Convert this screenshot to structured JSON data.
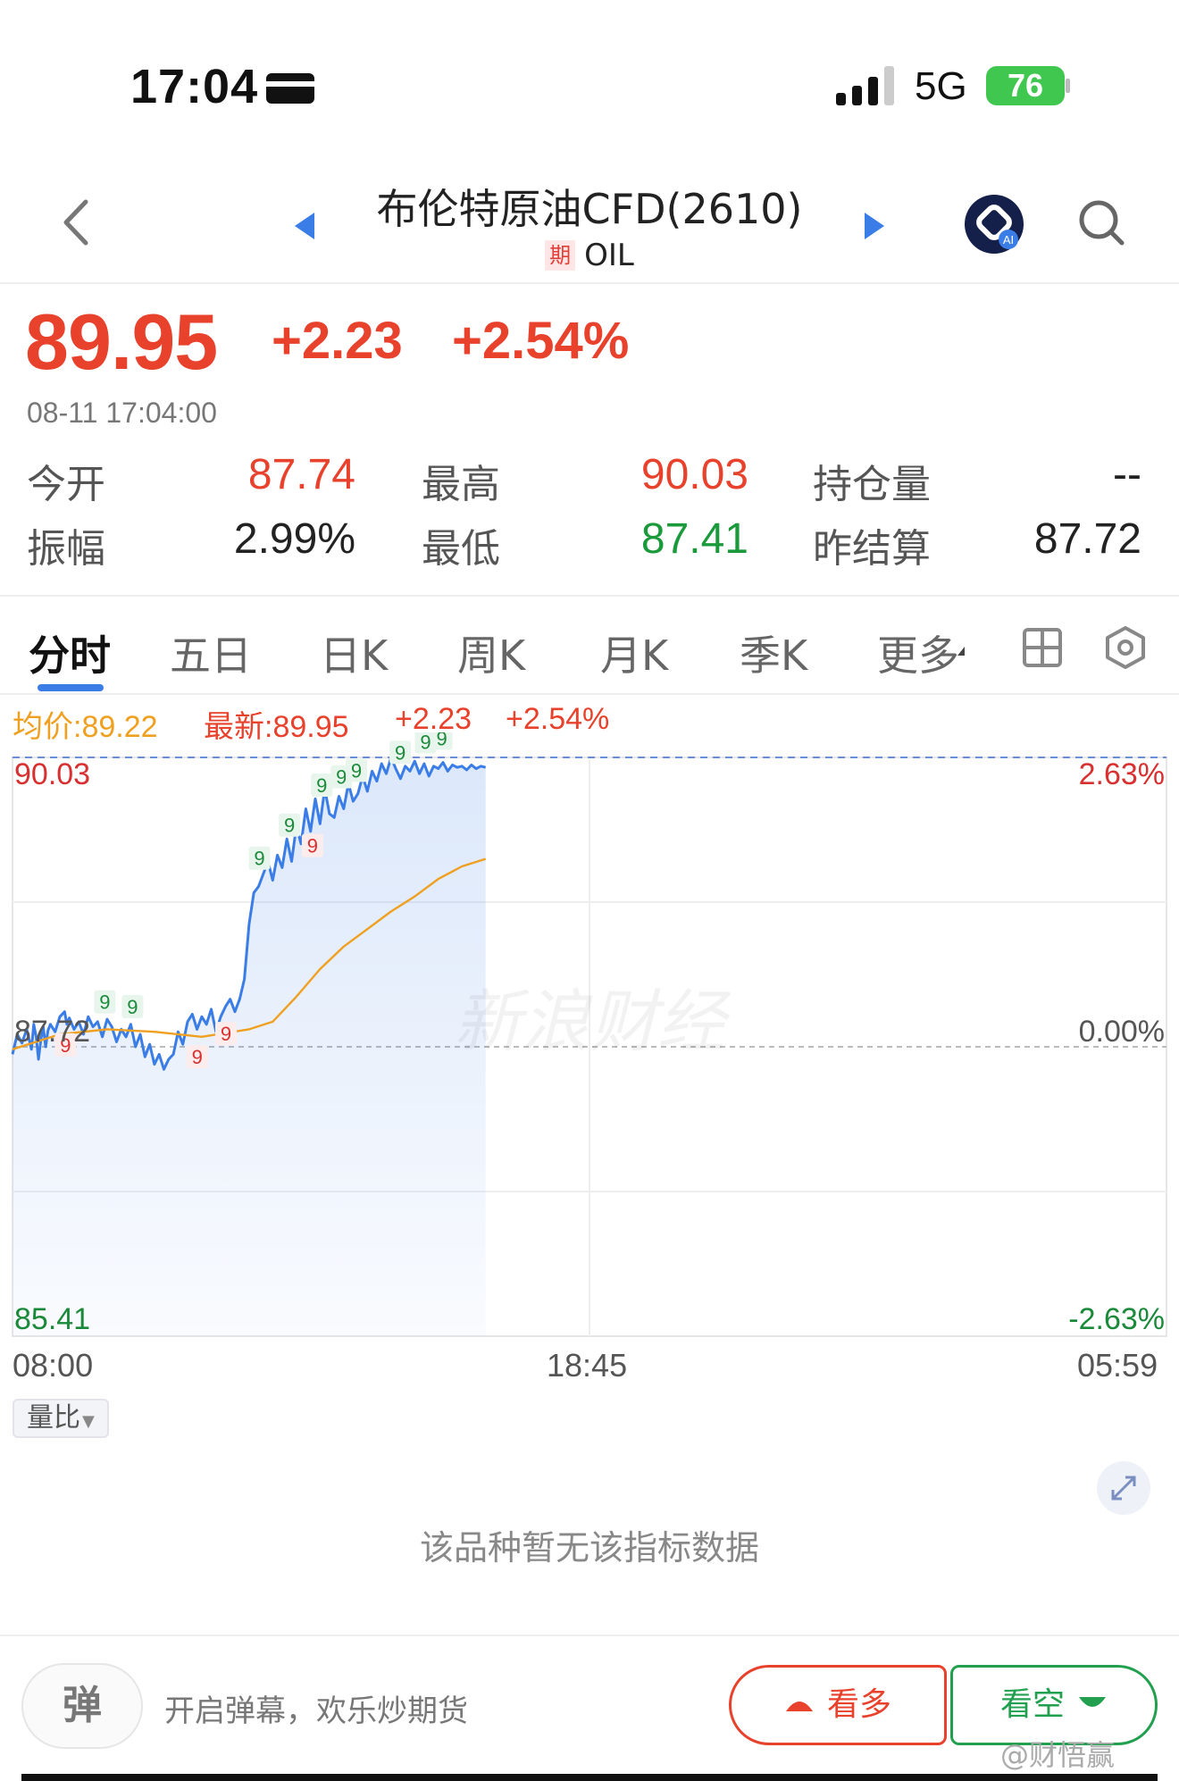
{
  "status_bar": {
    "time": "17:04",
    "network": "5G",
    "battery": "76"
  },
  "nav": {
    "title": "布伦特原油CFD(2610)",
    "badge": "期",
    "code": "OIL",
    "ai_label": "AI"
  },
  "quote": {
    "price": "89.95",
    "change": "+2.23",
    "change_pct": "+2.54%",
    "timestamp": "08-11 17:04:00"
  },
  "stats": {
    "open_label": "今开",
    "open_value": "87.74",
    "high_label": "最高",
    "high_value": "90.03",
    "open_interest_label": "持仓量",
    "open_interest_value": "--",
    "amplitude_label": "振幅",
    "amplitude_value": "2.99%",
    "low_label": "最低",
    "low_value": "87.41",
    "prev_settle_label": "昨结算",
    "prev_settle_value": "87.72"
  },
  "tabs": [
    {
      "label": "分时",
      "active": true
    },
    {
      "label": "五日"
    },
    {
      "label": "日K"
    },
    {
      "label": "周K"
    },
    {
      "label": "月K"
    },
    {
      "label": "季K"
    },
    {
      "label": "更多"
    }
  ],
  "legend": {
    "avg": "均价:89.22",
    "latest": "最新:89.95",
    "change": "+2.23",
    "pct": "+2.54%"
  },
  "chart_data": {
    "type": "line",
    "y_labels_left": [
      "90.03",
      "87.72",
      "85.41"
    ],
    "y_labels_right": [
      "2.63%",
      "0.00%",
      "-2.63%"
    ],
    "x_labels": [
      "08:00",
      "18:45",
      "05:59"
    ],
    "ylim": [
      85.41,
      90.03
    ],
    "reference_price": 87.72,
    "grid": true,
    "watermark": "新浪财经",
    "series": [
      {
        "color": "#3b7de6",
        "x": [
          0,
          0.01,
          0.02,
          0.03,
          0.04,
          0.045,
          0.05,
          0.055,
          0.06,
          0.065,
          0.07,
          0.075,
          0.08,
          0.09,
          0.1,
          0.11,
          0.115,
          0.12,
          0.13,
          0.14,
          0.15,
          0.16,
          0.17,
          0.18,
          0.19,
          0.2,
          0.21,
          0.22,
          0.23,
          0.24,
          0.25,
          0.26,
          0.27,
          0.28,
          0.29,
          0.3,
          0.31,
          0.32,
          0.33,
          0.34,
          0.35,
          0.36,
          0.37,
          0.38,
          0.39,
          0.4,
          0.41,
          0.42,
          0.43,
          0.44,
          0.45,
          0.46,
          0.47,
          0.48,
          0.49,
          0.5,
          0.51,
          0.52,
          0.53,
          0.54,
          0.55,
          0.56,
          0.57,
          0.58,
          0.59,
          0.6,
          0.61,
          0.62,
          0.63,
          0.64,
          0.65,
          0.66,
          0.67,
          0.68,
          0.69,
          0.7,
          0.71,
          0.72,
          0.73,
          0.74,
          0.75,
          0.76,
          0.77,
          0.78,
          0.79,
          0.8,
          0.81,
          0.82,
          0.83,
          0.84,
          0.85,
          0.86,
          0.87,
          0.88,
          0.89,
          0.9,
          0.91,
          0.92,
          0.93,
          0.94,
          0.95,
          0.96,
          0.97,
          0.98,
          0.99,
          1.0
        ],
        "values": [
          87.66,
          87.82,
          87.75,
          87.86,
          87.7,
          87.9,
          87.8,
          87.62,
          87.78,
          87.88,
          87.72,
          87.85,
          87.9,
          87.84,
          87.96,
          88.0,
          87.9,
          87.95,
          87.86,
          87.92,
          87.82,
          87.96,
          87.88,
          87.92,
          87.8,
          87.94,
          87.88,
          87.76,
          87.86,
          87.8,
          87.9,
          87.72,
          87.82,
          87.64,
          87.74,
          87.58,
          87.66,
          87.54,
          87.62,
          87.66,
          87.84,
          87.74,
          87.92,
          87.98,
          87.86,
          87.96,
          87.9,
          88.02,
          87.84,
          87.96,
          88.04,
          88.1,
          88.0,
          88.1,
          88.26,
          88.7,
          88.95,
          89.0,
          89.1,
          89.2,
          89.05,
          89.25,
          89.15,
          89.38,
          89.2,
          89.48,
          89.34,
          89.62,
          89.44,
          89.7,
          89.5,
          89.78,
          89.58,
          89.55,
          89.72,
          89.62,
          89.82,
          89.68,
          89.74,
          89.88,
          89.76,
          89.92,
          89.84,
          89.98,
          89.9,
          90.03,
          89.94,
          89.86,
          89.96,
          89.92,
          90.0,
          89.9,
          89.98,
          89.88,
          89.96,
          89.94,
          89.99,
          89.92,
          89.97,
          89.95,
          89.96,
          89.93,
          89.97,
          89.94,
          89.96,
          89.95
        ]
      },
      {
        "color": "#f0a020",
        "x": [
          0,
          0.1,
          0.2,
          0.3,
          0.4,
          0.5,
          0.55,
          0.6,
          0.65,
          0.7,
          0.75,
          0.8,
          0.85,
          0.9,
          0.95,
          1.0
        ],
        "values": [
          87.7,
          87.82,
          87.86,
          87.84,
          87.8,
          87.86,
          87.92,
          88.12,
          88.34,
          88.52,
          88.66,
          88.8,
          88.92,
          89.06,
          89.16,
          89.22
        ]
      }
    ],
    "session_fraction": 0.41,
    "markers": [
      {
        "x": 0.046,
        "label": "9",
        "color": "red",
        "pos": "below"
      },
      {
        "x": 0.16,
        "label": "9",
        "color": "red",
        "pos": "below"
      },
      {
        "x": 0.185,
        "label": "9",
        "color": "red",
        "pos": "below"
      },
      {
        "x": 0.26,
        "label": "9",
        "color": "red",
        "pos": "below"
      },
      {
        "x": 0.08,
        "label": "9",
        "color": "green",
        "pos": "above"
      },
      {
        "x": 0.104,
        "label": "9",
        "color": "green",
        "pos": "above"
      },
      {
        "x": 0.214,
        "label": "9",
        "color": "green",
        "pos": "above"
      },
      {
        "x": 0.24,
        "label": "9",
        "color": "green",
        "pos": "above"
      },
      {
        "x": 0.268,
        "label": "9",
        "color": "green",
        "pos": "above"
      },
      {
        "x": 0.285,
        "label": "9",
        "color": "green",
        "pos": "above"
      },
      {
        "x": 0.298,
        "label": "9",
        "color": "green",
        "pos": "above"
      },
      {
        "x": 0.336,
        "label": "9",
        "color": "green",
        "pos": "above"
      },
      {
        "x": 0.358,
        "label": "9",
        "color": "green",
        "pos": "above"
      },
      {
        "x": 0.372,
        "label": "9",
        "color": "green",
        "pos": "above"
      }
    ]
  },
  "indicator": {
    "selector_label": "量比",
    "empty_text": "该品种暂无该指标数据"
  },
  "bottom_bar": {
    "danmaku_label": "弹",
    "danmaku_hint": "开启弹幕，欢乐炒期货",
    "bullish_label": "看多",
    "bearish_label": "看空",
    "source_watermark": "@财悟赢"
  },
  "colors": {
    "up": "#e8412c",
    "down": "#1a9a3a",
    "accent": "#3b7de6",
    "avg": "#f0a020"
  }
}
